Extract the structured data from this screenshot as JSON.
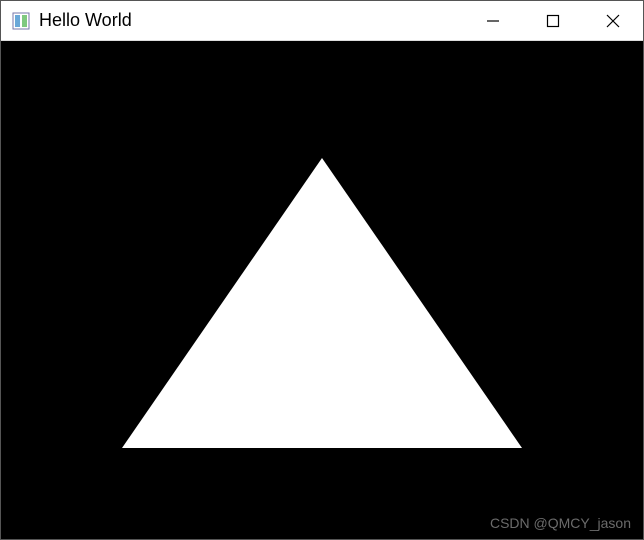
{
  "window": {
    "title": "Hello World"
  },
  "content": {
    "background_color": "#000000",
    "shape": "triangle",
    "shape_color": "#ffffff"
  },
  "watermark": {
    "text": "CSDN @QMCY_jason"
  }
}
